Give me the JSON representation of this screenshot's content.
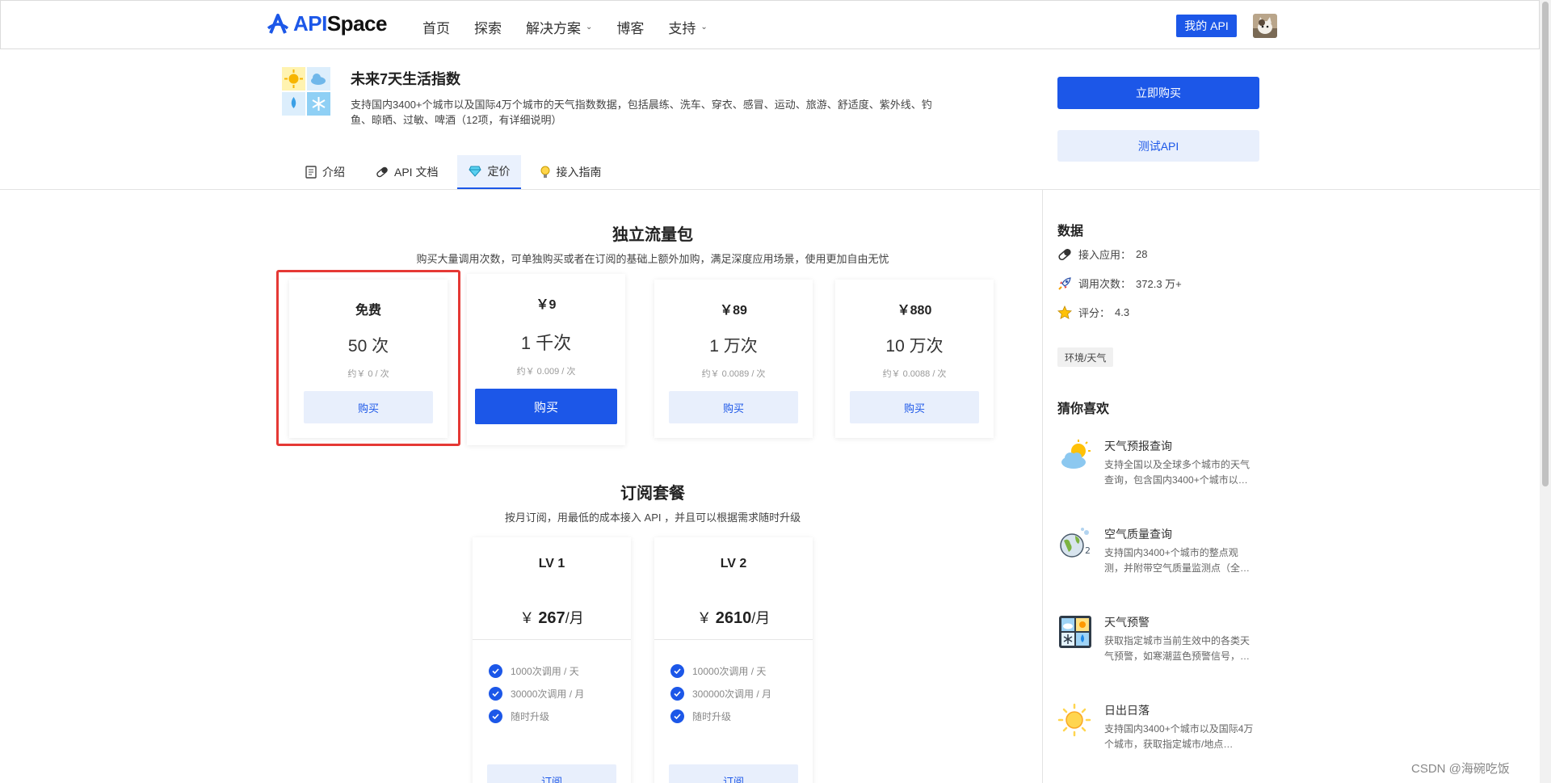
{
  "nav": {
    "logo_api": "API",
    "logo_space": "Space",
    "links": [
      {
        "label": "首页"
      },
      {
        "label": "探索"
      },
      {
        "label": "解决方案",
        "has_dropdown": true
      },
      {
        "label": "博客"
      },
      {
        "label": "支持",
        "has_dropdown": true
      }
    ],
    "my_api": "我的 API"
  },
  "product": {
    "title": "未来7天生活指数",
    "description": "支持国内3400+个城市以及国际4万个城市的天气指数数据，包括晨练、洗车、穿衣、感冒、运动、旅游、舒适度、紫外线、钓鱼、晾晒、过敏、啤酒（12项，有详细说明）",
    "buy_now": "立即购买",
    "test_api": "测试API"
  },
  "tabs": [
    {
      "label": "介绍",
      "icon": "document-icon"
    },
    {
      "label": "API 文档",
      "icon": "pill-icon"
    },
    {
      "label": "定价",
      "icon": "diamond-icon",
      "active": true
    },
    {
      "label": "接入指南",
      "icon": "bulb-icon"
    }
  ],
  "packs": {
    "title": "独立流量包",
    "subtitle": "购买大量调用次数，可单独购买或者在订阅的基础上额外加购，满足深度应用场景，使用更加自由无忧",
    "items": [
      {
        "price": "免费",
        "count": "50 次",
        "unit_price": "约￥ 0 / 次",
        "button": "购买"
      },
      {
        "price": "￥9",
        "count": "1 千次",
        "unit_price": "约￥ 0.009 / 次",
        "button": "购买"
      },
      {
        "price": "￥89",
        "count": "1 万次",
        "unit_price": "约￥ 0.0089 / 次",
        "button": "购买"
      },
      {
        "price": "￥880",
        "count": "10 万次",
        "unit_price": "约￥ 0.0088 / 次",
        "button": "购买"
      }
    ]
  },
  "subscriptions": {
    "title": "订阅套餐",
    "subtitle": "按月订阅，用最低的成本接入 API ，并且可以根据需求随时升级",
    "plans": [
      {
        "level": "LV 1",
        "currency": "￥",
        "amount": "267",
        "period": "/月",
        "features": [
          "1000次调用 / 天",
          "30000次调用 / 月",
          "随时升级"
        ],
        "button": "订阅"
      },
      {
        "level": "LV 2",
        "currency": "￥",
        "amount": "2610",
        "period": "/月",
        "features": [
          "10000次调用 / 天",
          "300000次调用 / 月",
          "随时升级"
        ],
        "button": "订阅"
      }
    ]
  },
  "sidebar": {
    "data_title": "数据",
    "stats": [
      {
        "label": "接入应用：",
        "value": "28",
        "icon": "pill-icon"
      },
      {
        "label": "调用次数：",
        "value": "372.3 万+",
        "icon": "rocket-icon"
      },
      {
        "label": "评分：",
        "value": "4.3",
        "icon": "star-icon"
      }
    ],
    "tag": "环境/天气",
    "recommend_title": "猜你喜欢",
    "recommendations": [
      {
        "title": "天气预报查询",
        "desc": "支持全国以及全球多个城市的天气查询，包含国内3400+个城市以…",
        "icon": "sun-cloud-icon"
      },
      {
        "title": "空气质量查询",
        "desc": "支持国内3400+个城市的整点观测，并附带空气质量监测点（全…",
        "icon": "globe-co2-icon"
      },
      {
        "title": "天气预警",
        "desc": "获取指定城市当前生效中的各类天气预警，如寒潮蓝色预警信号，…",
        "icon": "weather-grid-icon"
      },
      {
        "title": "日出日落",
        "desc": "支持国内3400+个城市以及国际4万个城市，获取指定城市/地点…",
        "icon": "sun-icon"
      }
    ]
  },
  "watermark": "CSDN @海碗吃饭"
}
